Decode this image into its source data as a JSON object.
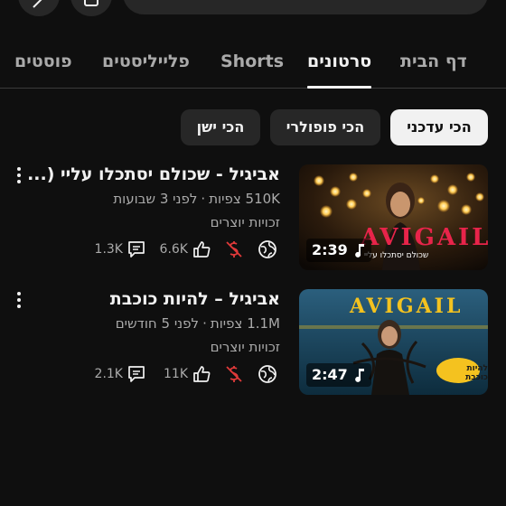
{
  "tabs": [
    {
      "label": "דף הבית",
      "active": false
    },
    {
      "label": "סרטונים",
      "active": true
    },
    {
      "label": "Shorts",
      "active": false
    },
    {
      "label": "פלייליסטים",
      "active": false
    },
    {
      "label": "פוסטים",
      "active": false
    }
  ],
  "filters": [
    {
      "label": "הכי עדכני",
      "active": true
    },
    {
      "label": "הכי פופולרי",
      "active": false
    },
    {
      "label": "הכי ישן",
      "active": false
    }
  ],
  "videos": [
    {
      "title": "אביגיל - שכולם יסתכלו עליי (...",
      "views": "510K צפיות",
      "age": "לפני 3 שבועות",
      "rights": "זכויות יוצרים",
      "likes": "6.6K",
      "comments": "1.3K",
      "duration": "2:39",
      "thumb_text": "AVIGAIL",
      "thumb_subtitle": "שכולם יסתכלו עליי"
    },
    {
      "title": "אביגיל – להיות כוכבת",
      "views": "1.1M צפיות",
      "age": "לפני 5 חודשים",
      "rights": "זכויות יוצרים",
      "likes": "11K",
      "comments": "2.1K",
      "duration": "2:47",
      "thumb_text": "AVIGAIL",
      "thumb_badge": "להיות כוכבת"
    }
  ],
  "colors": {
    "background": "#0f0f0f",
    "chip_bg": "#272727",
    "text_primary": "#f1f1f1",
    "text_secondary": "#aaaaaa",
    "monetization_icon": "#e03a3a",
    "thumb1_text": "#e8244a",
    "thumb2_text": "#f4c21f"
  },
  "icons": {
    "comment": "comment-icon",
    "like": "thumbs-up-icon",
    "monetization": "monetization-off-icon",
    "visibility": "globe-icon",
    "menu": "more-vert-icon",
    "music": "music-note-icon"
  }
}
